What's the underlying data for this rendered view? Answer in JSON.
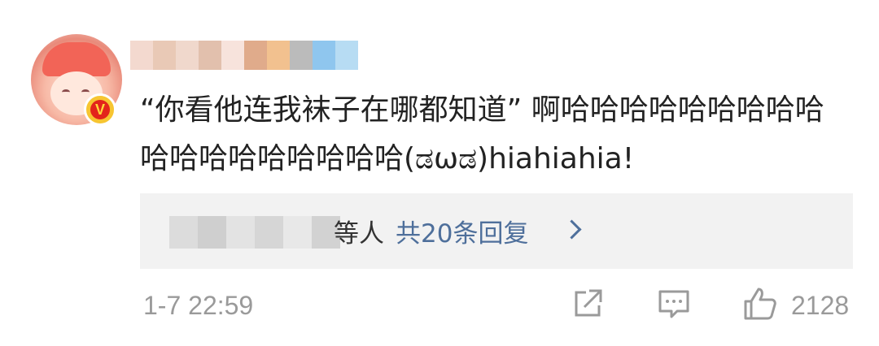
{
  "comment": {
    "text": "“你看他连我袜子在哪都知道” 啊哈哈哈哈哈哈哈哈哈哈哈哈哈哈哈哈哈哈(ಡωಡ)hiahiahia!"
  },
  "user": {
    "badge_letter": "V",
    "username_blur_colors": [
      "#f3d9cf",
      "#e9c9b6",
      "#f0d8cc",
      "#e2c0ad",
      "#f7e3dc",
      "#e0ab8b",
      "#f2c18f",
      "#bbbbbb",
      "#8fc6ee",
      "#b7dcf3"
    ]
  },
  "replies": {
    "names_suffix": "等人",
    "count_label": "共20条回复",
    "blur_colors": [
      "#dcdcdc",
      "#cfcfcf",
      "#e3e3e3",
      "#d6d6d6",
      "#e8e8e8",
      "#d2d2d2"
    ]
  },
  "footer": {
    "timestamp": "1-7 22:59",
    "like_count": "2128"
  },
  "icons": [
    "share-icon",
    "comment-icon",
    "like-icon",
    "chevron-right-icon"
  ],
  "colors": {
    "link": "#4e6f9b",
    "meta": "#9a9a9a",
    "text": "#222222",
    "badge_red": "#e3241b",
    "badge_gold": "#f7c531"
  }
}
